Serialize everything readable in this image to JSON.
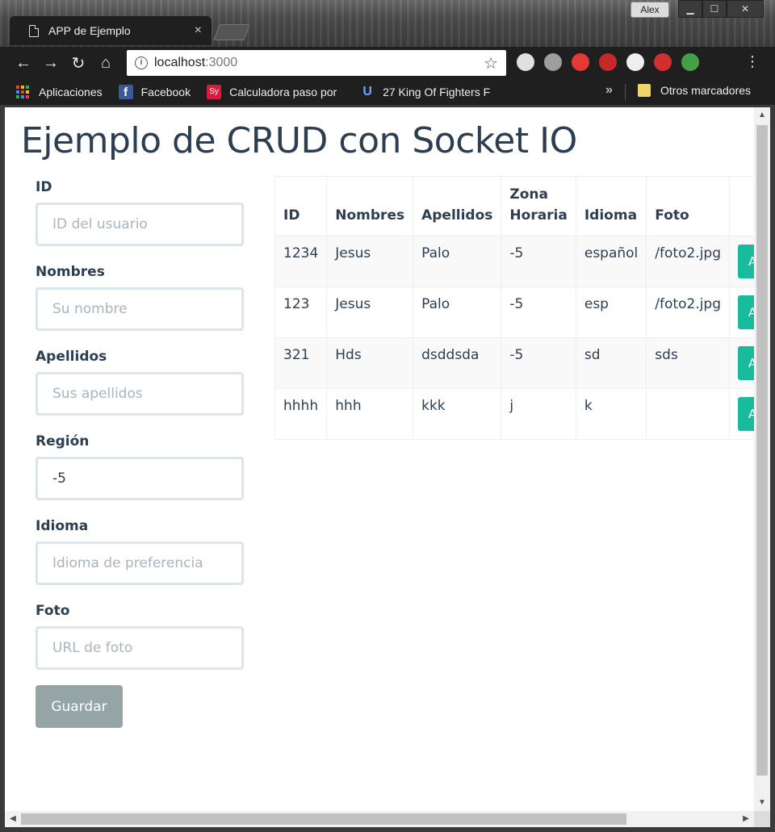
{
  "window": {
    "user": "Alex",
    "controls": {
      "minimize": "▁",
      "maximize": "☐",
      "close": "✕"
    }
  },
  "tab": {
    "title": "APP de Ejemplo",
    "close": "×"
  },
  "toolbar": {
    "back": "←",
    "forward": "→",
    "reload": "↻",
    "home": "⌂",
    "url_host": "localhost",
    "url_port": ":3000",
    "star": "☆",
    "menu": "⋮",
    "extensions": [
      {
        "name": "speedometer-extension-icon",
        "color": "#e0e0e0"
      },
      {
        "name": "drive-extension-icon",
        "color": "#9e9e9e"
      },
      {
        "name": "adblock-extension-icon",
        "color": "#e53935"
      },
      {
        "name": "red-extension-icon",
        "color": "#c62828"
      },
      {
        "name": "cube-extension-icon",
        "color": "#eeeeee"
      },
      {
        "name": "mcafee-extension-icon",
        "color": "#d32f2f"
      },
      {
        "name": "globe-extension-icon",
        "color": "#43a047"
      }
    ]
  },
  "bookmarks": {
    "items": [
      {
        "label": "Aplicaciones",
        "icon": "apps-icon"
      },
      {
        "label": "Facebook",
        "icon": "facebook-icon",
        "color": "#3b5998",
        "glyph": "f"
      },
      {
        "label": "Calculadora paso por",
        "icon": "symbolab-icon",
        "color": "#d81b3c",
        "glyph": "Sy"
      },
      {
        "label": "27 King Of Fighters F",
        "icon": "kof-icon",
        "color": "#6aa7ff",
        "glyph": "U"
      }
    ],
    "more": "»",
    "other": "Otros marcadores"
  },
  "page": {
    "title": "Ejemplo de CRUD con Socket IO",
    "form": {
      "id_label": "ID",
      "id_placeholder": "ID del usuario",
      "id_value": "",
      "nombres_label": "Nombres",
      "nombres_placeholder": "Su nombre",
      "nombres_value": "",
      "apellidos_label": "Apellidos",
      "apellidos_placeholder": "Sus apellidos",
      "apellidos_value": "",
      "region_label": "Región",
      "region_placeholder": "",
      "region_value": "-5",
      "idioma_label": "Idioma",
      "idioma_placeholder": "Idioma de preferencia",
      "idioma_value": "",
      "foto_label": "Foto",
      "foto_placeholder": "URL de foto",
      "foto_value": "",
      "save_label": "Guardar"
    },
    "table": {
      "headers": [
        "ID",
        "Nombres",
        "Apellidos",
        "Zona Horaria",
        "Idioma",
        "Foto",
        ""
      ],
      "rows": [
        {
          "id": "1234",
          "nombres": "Jesus",
          "apellidos": "Palo",
          "zona": "-5",
          "idioma": "español",
          "foto": "/foto2.jpg",
          "action": "Actu"
        },
        {
          "id": "123",
          "nombres": "Jesus",
          "apellidos": "Palo",
          "zona": "-5",
          "idioma": "esp",
          "foto": "/foto2.jpg",
          "action": "Actu"
        },
        {
          "id": "321",
          "nombres": "Hds",
          "apellidos": "dsddsda",
          "zona": "-5",
          "idioma": "sd",
          "foto": "sds",
          "action": "Actu"
        },
        {
          "id": "hhhh",
          "nombres": "hhh",
          "apellidos": "kkk",
          "zona": "j",
          "idioma": "k",
          "foto": "",
          "action": "Actu"
        }
      ]
    }
  },
  "colors": {
    "heading": "#2c3e50",
    "primary_button": "#18bc9c",
    "secondary_button": "#95a5a6",
    "input_border": "#dce4ec"
  }
}
